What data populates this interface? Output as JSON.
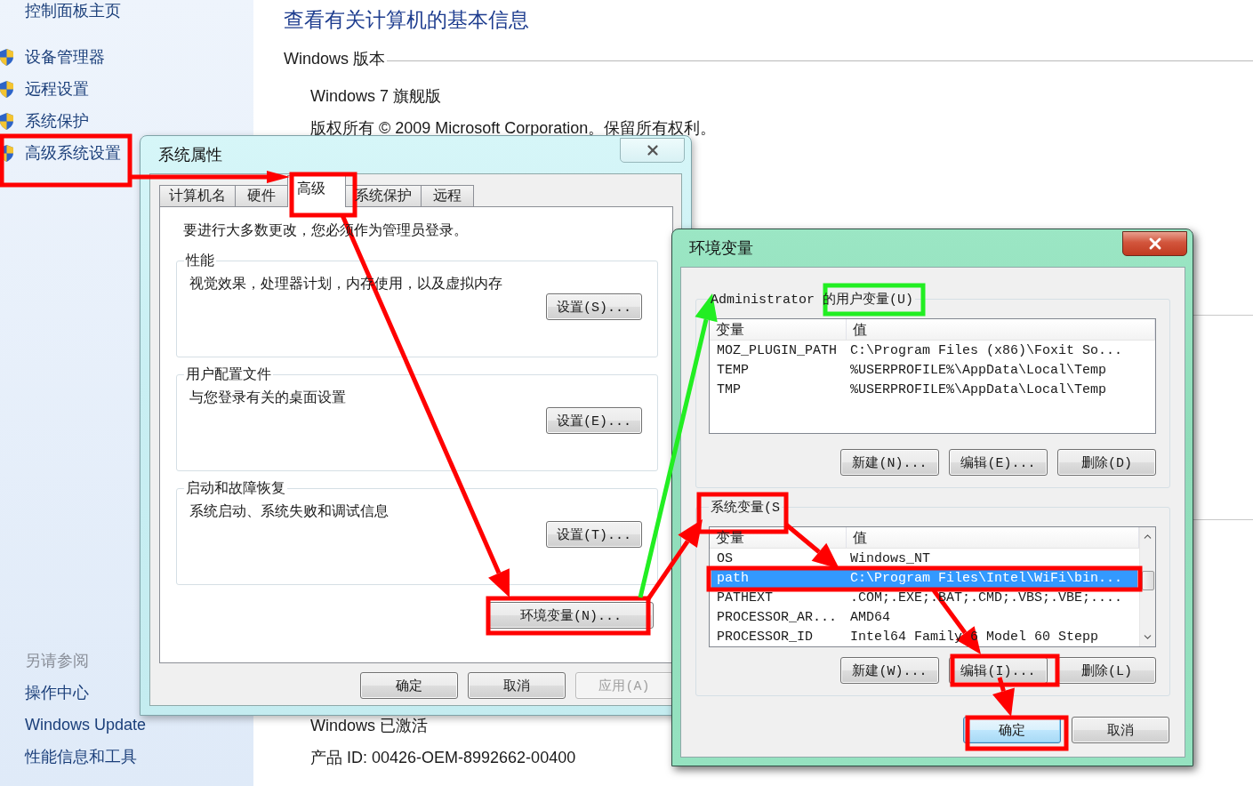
{
  "control_panel": {
    "sidebar": {
      "home_link": "控制面板主页",
      "tasks": [
        {
          "label": "设备管理器"
        },
        {
          "label": "远程设置"
        },
        {
          "label": "系统保护"
        },
        {
          "label": "高级系统设置"
        }
      ],
      "see_also_heading": "另请参阅",
      "see_also": [
        "操作中心",
        "Windows Update",
        "性能信息和工具"
      ]
    },
    "main": {
      "title": "查看有关计算机的基本信息",
      "edition_heading": "Windows 版本",
      "edition": "Windows 7 旗舰版",
      "copyright": "版权所有 © 2009 Microsoft Corporation。保留所有权利。",
      "activation": "Windows 已激活",
      "product_id": "产品 ID: 00426-OEM-8992662-00400"
    }
  },
  "system_properties": {
    "title": "系统属性",
    "active": false,
    "tabs": [
      {
        "label": "计算机名",
        "selected": false
      },
      {
        "label": "硬件",
        "selected": false
      },
      {
        "label": "高级",
        "selected": true
      },
      {
        "label": "系统保护",
        "selected": false
      },
      {
        "label": "远程",
        "selected": false
      }
    ],
    "admin_note": "要进行大多数更改，您必须作为管理员登录。",
    "groups": [
      {
        "title": "性能",
        "description": "视觉效果，处理器计划，内存使用，以及虚拟内存",
        "button": "设置(S)..."
      },
      {
        "title": "用户配置文件",
        "description": "与您登录有关的桌面设置",
        "button": "设置(E)..."
      },
      {
        "title": "启动和故障恢复",
        "description": "系统启动、系统失败和调试信息",
        "button": "设置(T)..."
      }
    ],
    "env_button": "环境变量(N)...",
    "buttons": [
      {
        "label": "确定",
        "disabled": false
      },
      {
        "label": "取消",
        "disabled": false
      },
      {
        "label": "应用(A)",
        "disabled": true
      }
    ]
  },
  "environment_variables": {
    "title": "环境变量",
    "active": true,
    "user_group": {
      "label": "Administrator 的用户变量(U)",
      "columns": [
        "变量",
        "值"
      ],
      "scrollable": false,
      "rows": [
        {
          "name": "MOZ_PLUGIN_PATH",
          "value": "C:\\Program Files (x86)\\Foxit So...",
          "selected": false
        },
        {
          "name": "TEMP",
          "value": "%USERPROFILE%\\AppData\\Local\\Temp",
          "selected": false
        },
        {
          "name": "TMP",
          "value": "%USERPROFILE%\\AppData\\Local\\Temp",
          "selected": false
        }
      ],
      "buttons": [
        "新建(N)...",
        "编辑(E)...",
        "删除(D)"
      ]
    },
    "system_group": {
      "label": "系统变量(S",
      "columns": [
        "变量",
        "值"
      ],
      "scrollable": true,
      "rows": [
        {
          "name": "OS",
          "value": "Windows_NT",
          "selected": false
        },
        {
          "name": "path",
          "value": "C:\\Program Files\\Intel\\WiFi\\bin...",
          "selected": true
        },
        {
          "name": "PATHEXT",
          "value": ".COM;.EXE;.BAT;.CMD;.VBS;.VBE;....",
          "selected": false
        },
        {
          "name": "PROCESSOR_AR...",
          "value": "AMD64",
          "selected": false
        },
        {
          "name": "PROCESSOR_ID",
          "value": "Intel64 Family 6 Model 60 Stepp",
          "selected": false
        }
      ],
      "buttons": [
        "新建(W)...",
        "编辑(I)...",
        "删除(L)"
      ]
    },
    "buttons": [
      {
        "label": "确定",
        "default": true
      },
      {
        "label": "取消",
        "default": false
      }
    ]
  },
  "annotations": [
    {
      "kind": "frame",
      "color": "#ff0000"
    },
    {
      "kind": "arrow",
      "color": "#ff0000"
    },
    {
      "kind": "frame",
      "color": "#ff0000"
    },
    {
      "kind": "arrow",
      "color": "#ff0000"
    },
    {
      "kind": "frame",
      "color": "#ff0000"
    },
    {
      "kind": "arrow",
      "color": "#22ee22"
    },
    {
      "kind": "frame",
      "color": "#22ee22"
    },
    {
      "kind": "arrow",
      "color": "#ff0000"
    },
    {
      "kind": "frame",
      "color": "#ff0000"
    },
    {
      "kind": "arrow",
      "color": "#ff0000"
    },
    {
      "kind": "frame",
      "color": "#ff0000"
    },
    {
      "kind": "arrow",
      "color": "#ff0000"
    },
    {
      "kind": "frame",
      "color": "#ff0000"
    },
    {
      "kind": "arrow",
      "color": "#ff0000"
    },
    {
      "kind": "frame",
      "color": "#ff0000"
    }
  ]
}
